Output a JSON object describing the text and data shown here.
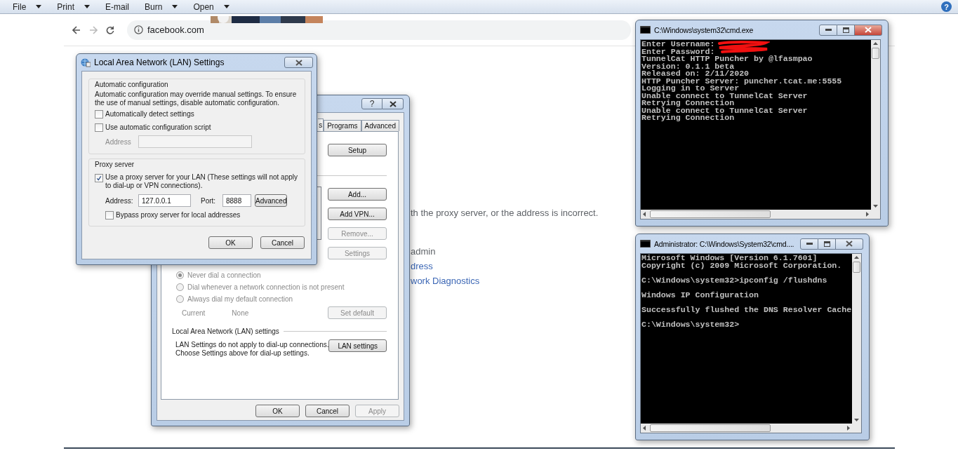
{
  "toolbar": {
    "items": [
      {
        "label": "File",
        "dropdown": true
      },
      {
        "label": "Print",
        "dropdown": true
      },
      {
        "label": "E-mail",
        "dropdown": false
      },
      {
        "label": "Burn",
        "dropdown": true
      },
      {
        "label": "Open",
        "dropdown": true
      }
    ],
    "help": "?"
  },
  "browser": {
    "url": "facebook.com",
    "page_lines": [
      {
        "kind": "text",
        "text": "th the proxy server, or the address is incorrect."
      },
      {
        "kind": "text",
        "text": "admin"
      },
      {
        "kind": "link",
        "text": "dress"
      },
      {
        "kind": "link",
        "text": "work Diagnostics"
      }
    ]
  },
  "internet_options": {
    "help": "?",
    "tabs": [
      {
        "label": "s",
        "selected": true
      },
      {
        "label": "Programs",
        "selected": false
      },
      {
        "label": "Advanced",
        "selected": false
      }
    ],
    "setup_button": "Setup",
    "vpn_buttons": [
      {
        "label": "Add...",
        "disabled": false
      },
      {
        "label": "Add VPN...",
        "disabled": false
      },
      {
        "label": "Remove...",
        "disabled": true
      },
      {
        "label": "Settings",
        "disabled": true
      }
    ],
    "dial_options": [
      {
        "label": "Never dial a connection",
        "selected": true,
        "disabled": true
      },
      {
        "label": "Dial whenever a network connection is not present",
        "selected": false,
        "disabled": true
      },
      {
        "label": "Always dial my default connection",
        "selected": false,
        "disabled": true
      }
    ],
    "current_label": "Current",
    "current_value": "None",
    "set_default": {
      "label": "Set default",
      "disabled": true
    },
    "lan_group": "Local Area Network (LAN) settings",
    "lan_note": [
      "LAN Settings do not apply to dial-up connections.",
      "Choose Settings above for dial-up settings."
    ],
    "lan_button": "LAN settings",
    "buttons": [
      {
        "label": "OK",
        "disabled": false
      },
      {
        "label": "Cancel",
        "disabled": false
      },
      {
        "label": "Apply",
        "disabled": true
      }
    ]
  },
  "lan_dialog": {
    "title": "Local Area Network (LAN) Settings",
    "auto_group": "Automatic configuration",
    "auto_note": "Automatic configuration may override manual settings. To ensure the use of manual settings, disable automatic configuration.",
    "checks": [
      {
        "label": "Automatically detect settings",
        "checked": false
      },
      {
        "label": "Use automatic configuration script",
        "checked": false
      }
    ],
    "script_address": {
      "label": "Address",
      "disabled": true
    },
    "proxy_group": "Proxy server",
    "use_proxy": {
      "label": "Use a proxy server for your LAN (These settings will not apply to dial-up or VPN connections).",
      "checked": true
    },
    "address_label": "Address:",
    "address": "127.0.0.1",
    "port_label": "Port:",
    "port": "8888",
    "advanced_button": "Advanced",
    "bypass": {
      "label": "Bypass proxy server for local addresses",
      "checked": false
    },
    "buttons": [
      "OK",
      "Cancel"
    ]
  },
  "consoles": [
    {
      "title": "C:\\Windows\\system32\\cmd.exe",
      "active": true,
      "redacted": true,
      "blocks": [
        [
          "Enter Username:",
          "Enter Password:",
          "TunnelCat HTTP Puncher by @lfasmpao",
          "Version: 0.1.1 beta",
          "Released on: 2/11/2020",
          "HTTP Puncher Server: puncher.tcat.me:5555",
          "Logging in to Server",
          "Unable connect to TunnelCat Server",
          "Retrying Connection",
          "Unable connect to TunnelCat Server",
          "Retrying Connection"
        ]
      ]
    },
    {
      "title": "Administrator: C:\\Windows\\System32\\cmd....",
      "active": false,
      "redacted": false,
      "blocks": [
        [
          "Microsoft Windows [Version 6.1.7601]",
          "Copyright (c) 2009 Microsoft Corporation."
        ],
        [
          "C:\\Windows\\system32>ipconfig /flushdns"
        ],
        [
          "Windows IP Configuration"
        ],
        [
          "Successfully flushed the DNS Resolver Cache"
        ],
        [
          "C:\\Windows\\system32>"
        ]
      ]
    }
  ]
}
